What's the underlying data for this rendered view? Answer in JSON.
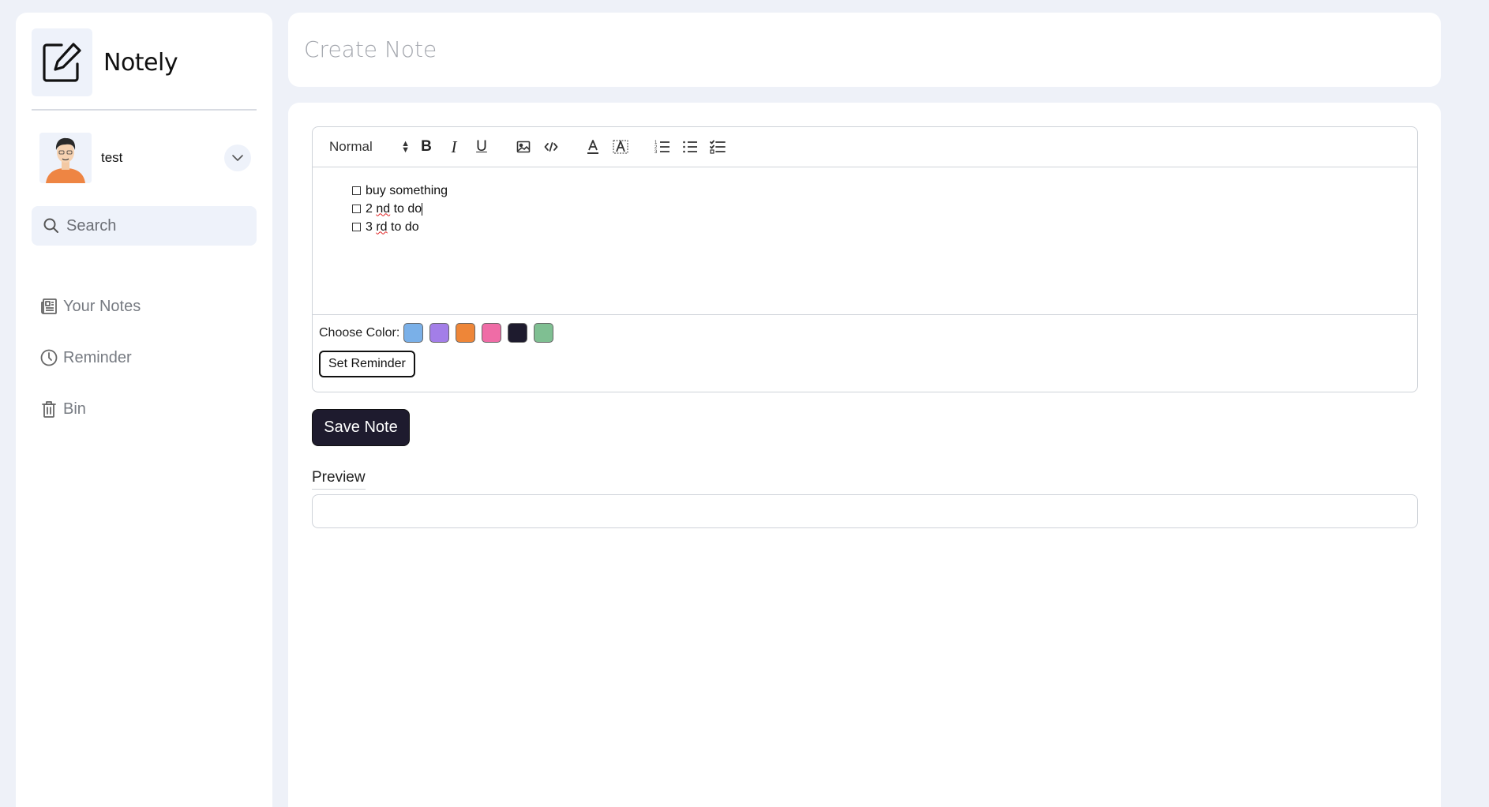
{
  "app": {
    "name": "Notely"
  },
  "user": {
    "name": "test"
  },
  "search": {
    "placeholder": "Search"
  },
  "nav": {
    "items": [
      {
        "label": "Your Notes",
        "icon": "notes-icon"
      },
      {
        "label": "Reminder",
        "icon": "clock-icon"
      },
      {
        "label": "Bin",
        "icon": "trash-icon"
      }
    ]
  },
  "header": {
    "title": "Create Note"
  },
  "editor": {
    "toolbar": {
      "format_select": "Normal",
      "bold": "B",
      "italic": "I",
      "underline": "U"
    },
    "checklist": [
      {
        "pre": "buy something",
        "flag": "",
        "post": ""
      },
      {
        "pre": "2 ",
        "flag": "nd",
        "post": " to do"
      },
      {
        "pre": "3 ",
        "flag": "rd",
        "post": " to do"
      }
    ]
  },
  "color_picker": {
    "label": "Choose Color:",
    "colors": [
      "#7ab0e8",
      "#a37ee8",
      "#ee8638",
      "#ef6ca6",
      "#1e1b2e",
      "#7fbf92"
    ]
  },
  "actions": {
    "set_reminder": "Set Reminder",
    "save_note": "Save Note"
  },
  "preview": {
    "label": "Preview"
  }
}
